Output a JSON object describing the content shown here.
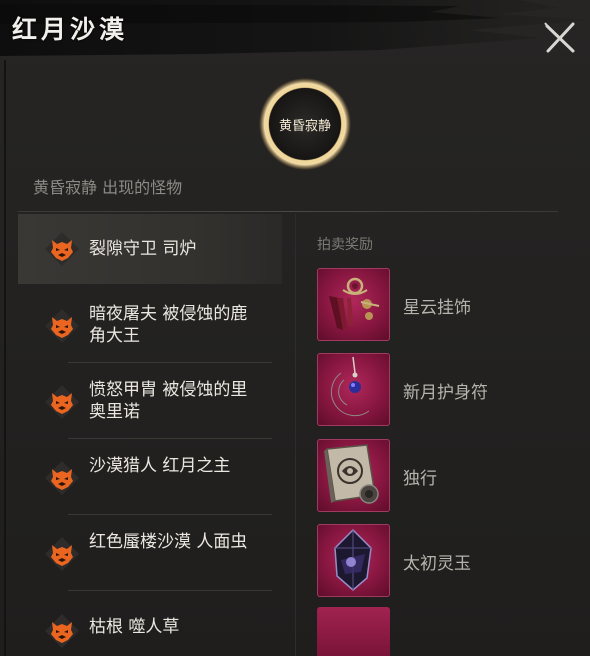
{
  "window": {
    "title": "红月沙漠",
    "close_icon": "close-x-icon"
  },
  "emblem": {
    "label": "黄昏寂静",
    "ring_color": "#e8c887"
  },
  "monsters_heading": "黄昏寂静 出现的怪物",
  "monsters": [
    {
      "name": "裂隙守卫 司炉",
      "icon": "demon-mask-icon",
      "selected": true
    },
    {
      "name": "暗夜屠夫 被侵蚀的鹿角大王",
      "icon": "demon-mask-icon",
      "selected": false
    },
    {
      "name": "愤怒甲胄 被侵蚀的里奥里诺",
      "icon": "demon-mask-icon",
      "selected": false
    },
    {
      "name": "沙漠猎人 红月之主",
      "icon": "demon-mask-icon",
      "selected": false
    },
    {
      "name": "红色蜃楼沙漠 人面虫",
      "icon": "demon-mask-icon",
      "selected": false
    },
    {
      "name": "枯根 噬人草",
      "icon": "demon-mask-icon",
      "selected": false
    }
  ],
  "rewards_heading": "拍卖奖励",
  "rewards": [
    {
      "name": "星云挂饰",
      "icon": "tassel-ornament-icon"
    },
    {
      "name": "新月护身符",
      "icon": "crescent-amulet-icon"
    },
    {
      "name": "独行",
      "icon": "tome-book-icon"
    },
    {
      "name": "太初灵玉",
      "icon": "dark-crystal-icon"
    }
  ],
  "colors": {
    "accent_orange": "#e8621e",
    "reward_bg": "#8a1842",
    "text_primary": "#ebe7e0",
    "text_muted": "#8d8a85"
  }
}
